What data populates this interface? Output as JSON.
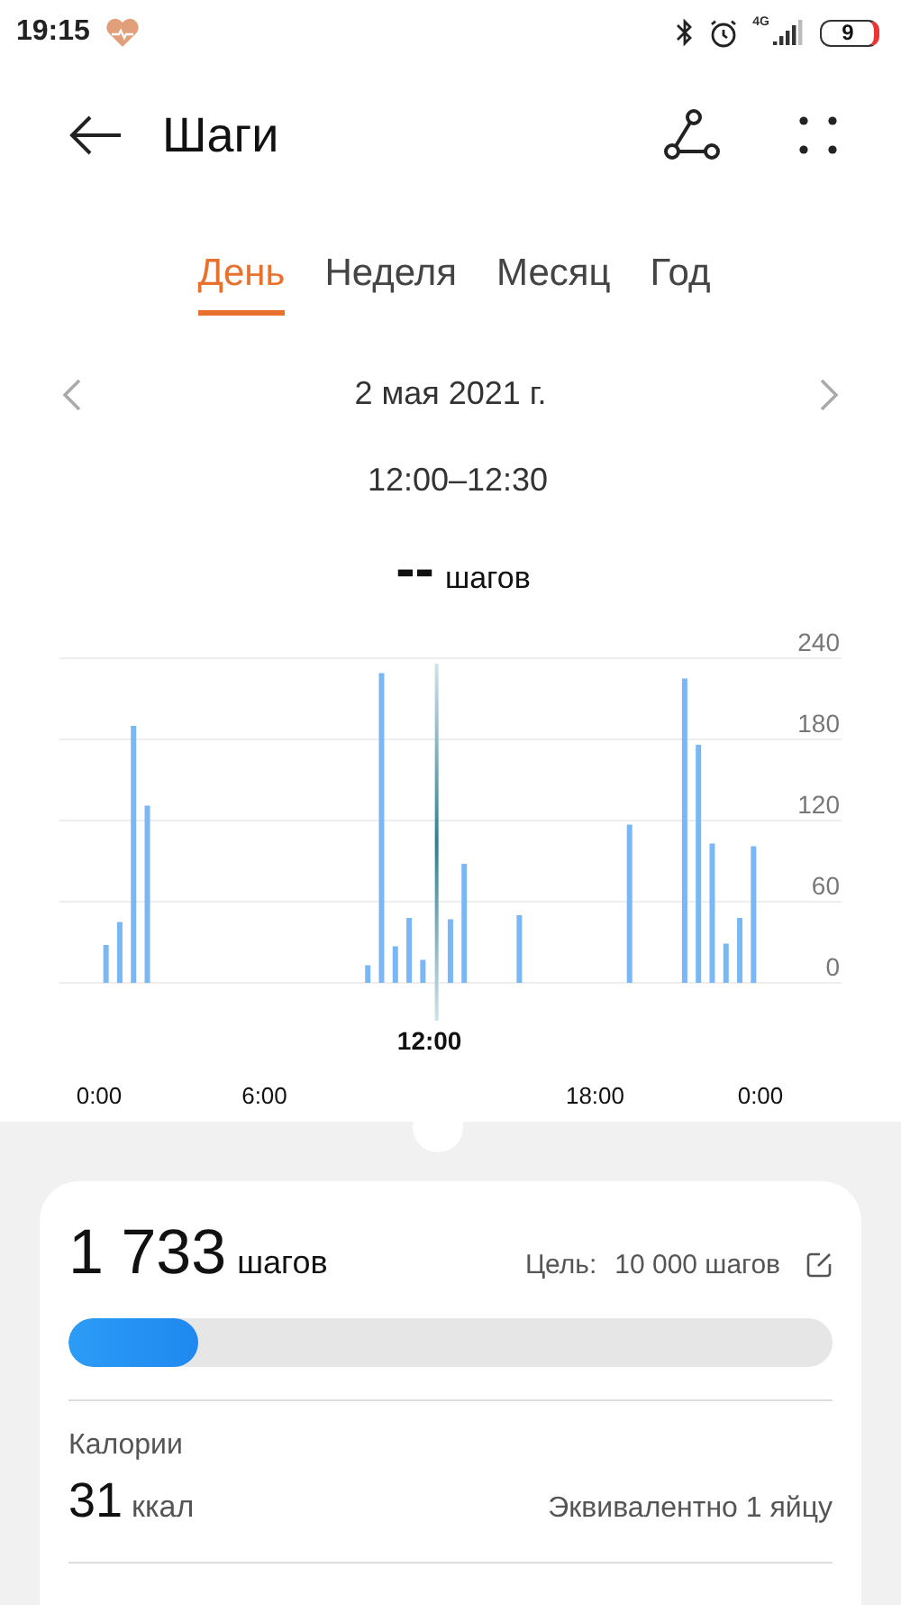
{
  "status_bar": {
    "time": "19:15",
    "network": "4G",
    "battery": "9"
  },
  "header": {
    "title": "Шаги"
  },
  "tabs": [
    {
      "label": "День",
      "selected": true
    },
    {
      "label": "Неделя",
      "selected": false
    },
    {
      "label": "Месяц",
      "selected": false
    },
    {
      "label": "Год",
      "selected": false
    }
  ],
  "date_nav": {
    "date": "2 мая 2021 г.",
    "time_range": "12:00–12:30"
  },
  "reading": {
    "value": "--",
    "unit": "шагов"
  },
  "chart": {
    "chart_data": {
      "type": "bar",
      "grid": true,
      "ref_lines": [
        {
          "axis": "x",
          "value": 12.25,
          "label": "12:00"
        }
      ],
      "x": [
        0,
        0.5,
        1,
        1.5,
        9.5,
        10,
        10.5,
        11,
        11.5,
        12.5,
        13,
        15,
        19,
        21,
        21.5,
        22,
        22.5,
        23,
        23.5
      ],
      "series": [
        {
          "color": "#7ab8f5",
          "values": [
            28,
            45,
            190,
            131,
            13,
            229,
            27,
            48,
            17,
            47,
            88,
            50,
            117,
            225,
            176,
            103,
            29,
            48,
            101
          ]
        }
      ],
      "xlim": [
        0,
        24
      ],
      "ylim": [
        0,
        240
      ],
      "xticks": [
        {
          "value": 0,
          "label": "0:00"
        },
        {
          "value": 6,
          "label": "6:00"
        },
        {
          "value": 18,
          "label": "18:00"
        },
        {
          "value": 24,
          "label": "0:00"
        }
      ],
      "yticks": [
        0,
        60,
        120,
        180,
        240
      ]
    }
  },
  "summary": {
    "steps": "1 733",
    "steps_unit": "шагов",
    "goal_label": "Цель:",
    "goal": "10 000 шагов",
    "level": 0.17
  },
  "calories": {
    "label": "Калории",
    "value": "31",
    "unit": "ккал",
    "equivalent": "Эквивалентно 1 яйцу"
  }
}
